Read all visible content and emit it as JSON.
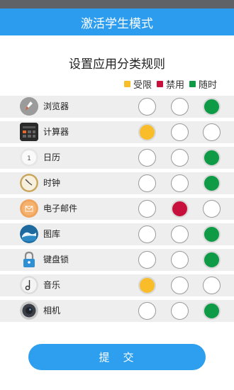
{
  "app_bar": {
    "title": "激活学生模式"
  },
  "subtitle": "设置应用分类规则",
  "legend": [
    {
      "label": "受限",
      "color": "#f8bd28"
    },
    {
      "label": "禁用",
      "color": "#c8103c"
    },
    {
      "label": "随时",
      "color": "#0f9a46"
    }
  ],
  "apps": [
    {
      "name": "浏览器",
      "icon": "rocket-browser-icon",
      "selected": 2
    },
    {
      "name": "计算器",
      "icon": "calculator-icon",
      "selected": 0
    },
    {
      "name": "日历",
      "icon": "calendar-icon",
      "selected": 2
    },
    {
      "name": "时钟",
      "icon": "clock-icon",
      "selected": 2
    },
    {
      "name": "电子邮件",
      "icon": "email-icon",
      "selected": 1
    },
    {
      "name": "图库",
      "icon": "gallery-wave-icon",
      "selected": 2
    },
    {
      "name": "键盘锁",
      "icon": "padlock-icon",
      "selected": 2
    },
    {
      "name": "音乐",
      "icon": "music-note-icon",
      "selected": 0
    },
    {
      "name": "相机",
      "icon": "camera-icon",
      "selected": 2
    }
  ],
  "submit_label": "提　交"
}
